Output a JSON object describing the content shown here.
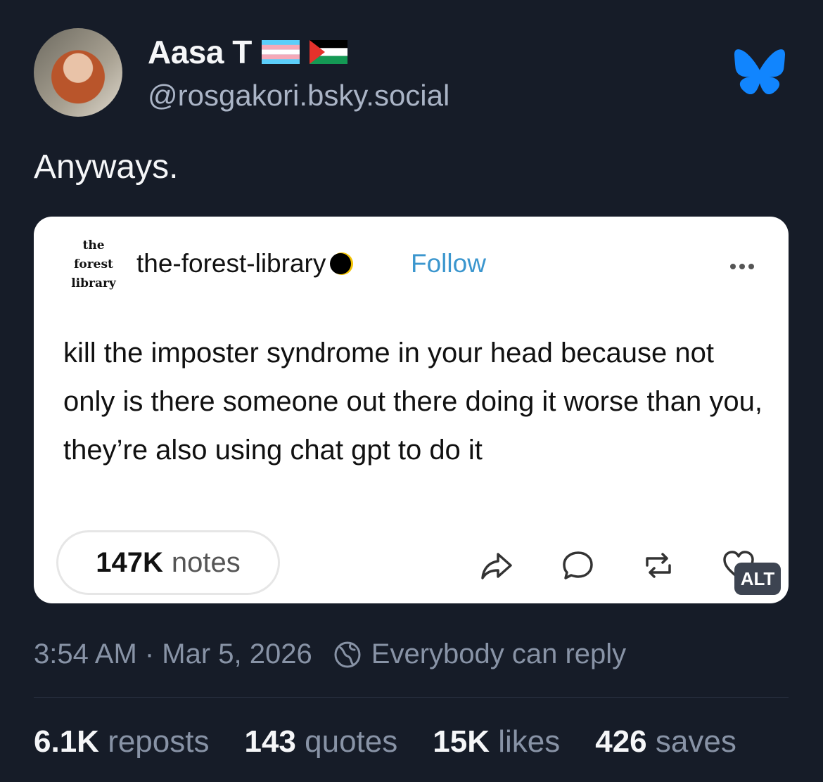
{
  "author": {
    "display_name": "Aasa T",
    "handle": "@rosgakori.bsky.social",
    "flags": [
      "transgender-flag-icon",
      "palestine-flag-icon"
    ]
  },
  "post": {
    "text": "Anyways."
  },
  "embed": {
    "logo_lines": [
      "the",
      "forest",
      "library"
    ],
    "blog_name": "the-forest-library",
    "follow_label": "Follow",
    "body": "kill the imposter syndrome in your head because not only is there someone out there doing it worse than you, they’re also using chat gpt to do it",
    "notes_count": "147K",
    "notes_label": "notes",
    "alt_label": "ALT"
  },
  "meta": {
    "timestamp": "3:54 AM · Mar 5, 2026",
    "reply_setting": "Everybody can reply"
  },
  "stats": [
    {
      "count": "6.1K",
      "label": "reposts"
    },
    {
      "count": "143",
      "label": "quotes"
    },
    {
      "count": "15K",
      "label": "likes"
    },
    {
      "count": "426",
      "label": "saves"
    }
  ],
  "colors": {
    "background": "#161c28",
    "bluesky_blue": "#1185fe",
    "follow_blue": "#3b96ce"
  }
}
